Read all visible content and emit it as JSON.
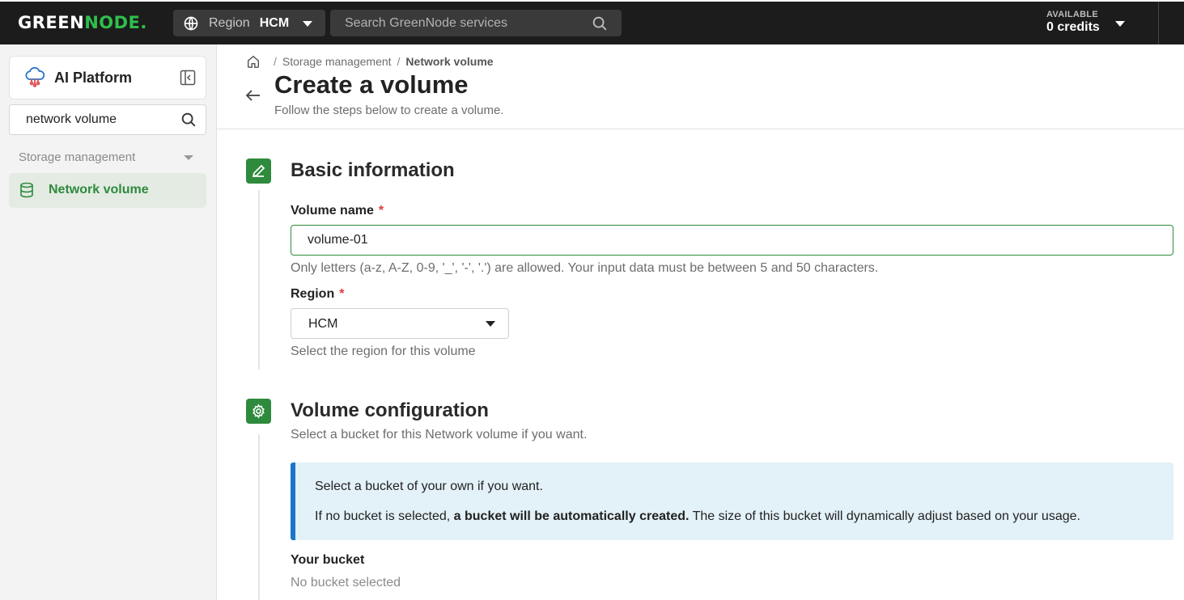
{
  "topbar": {
    "logo": {
      "part1": "GREEN",
      "part2": "NODE",
      "dot": "."
    },
    "region": {
      "label": "Region",
      "value": "HCM"
    },
    "search": {
      "placeholder": "Search GreenNode services"
    },
    "credits": {
      "label": "AVAILABLE",
      "value": "0 credits"
    }
  },
  "sidebar": {
    "platform_title": "AI Platform",
    "search_value": "network volume",
    "group_label": "Storage management",
    "active_item": "Network volume"
  },
  "breadcrumb": {
    "items": [
      "Storage management",
      "Network volume"
    ],
    "separator": "/"
  },
  "page": {
    "title": "Create a volume",
    "subtitle": "Follow the steps below to create a volume."
  },
  "basic": {
    "title": "Basic information",
    "name_label": "Volume name",
    "required_mark": "*",
    "name_value": "volume-01",
    "name_helper": "Only letters (a-z, A-Z, 0-9, '_', '-', '.') are allowed. Your input data must be between 5 and 50 characters.",
    "region_label": "Region",
    "region_value": "HCM",
    "region_helper": "Select the region for this volume"
  },
  "config": {
    "title": "Volume configuration",
    "subtitle": "Select a bucket for this Network volume if you want.",
    "info_line1": "Select a bucket of your own if you want.",
    "info_line2_prefix": "If no bucket is selected, ",
    "info_line2_bold": "a bucket will be automatically created.",
    "info_line2_suffix": " The size of this bucket will dynamically adjust based on your usage.",
    "bucket_label": "Your bucket",
    "bucket_value": "No bucket selected"
  },
  "colors": {
    "brand_green": "#2e8a3c",
    "info_blue": "#1976c9",
    "required_red": "#e23b3b"
  },
  "icons": [
    "globe-icon",
    "search-icon",
    "ai-platform-icon",
    "collapse-sidebar-icon",
    "database-icon",
    "home-icon",
    "back-arrow-icon",
    "pencil-icon",
    "gear-icon"
  ]
}
